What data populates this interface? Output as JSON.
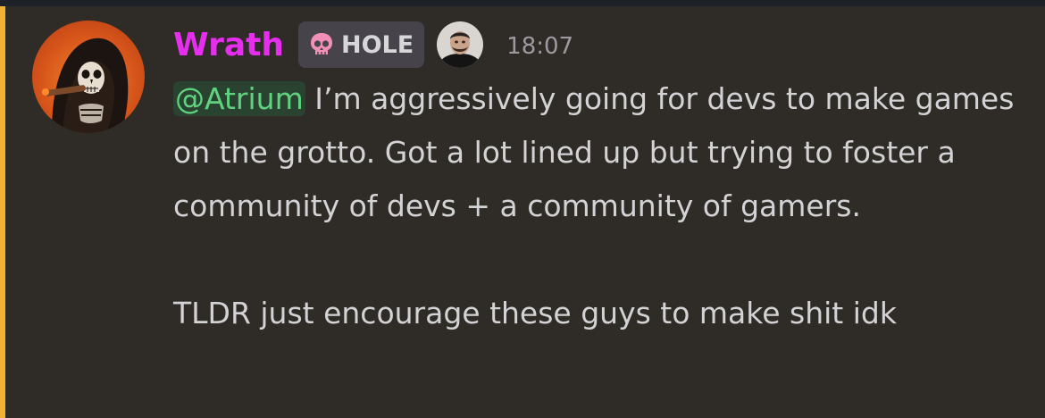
{
  "message": {
    "author": "Wrath",
    "tag": {
      "icon": "pink-skull-icon",
      "label": "HOLE"
    },
    "role_icon": "user-portrait-icon",
    "timestamp": "18:07",
    "mention": "@Atrium",
    "text": " I’m aggressively going for devs to make games on the grotto. Got a lot lined up but trying to foster a community of devs + a community of gamers.\n\nTLDR just encourage these guys to make shit idk"
  },
  "colors": {
    "background": "#2f2c27",
    "username": "#e62eee",
    "mention_bg": "#2a4330",
    "mention_text": "#5fd27f",
    "mention_bar": "#f0b232",
    "timestamp": "#9c9aa0",
    "text": "#d3d2d4"
  }
}
